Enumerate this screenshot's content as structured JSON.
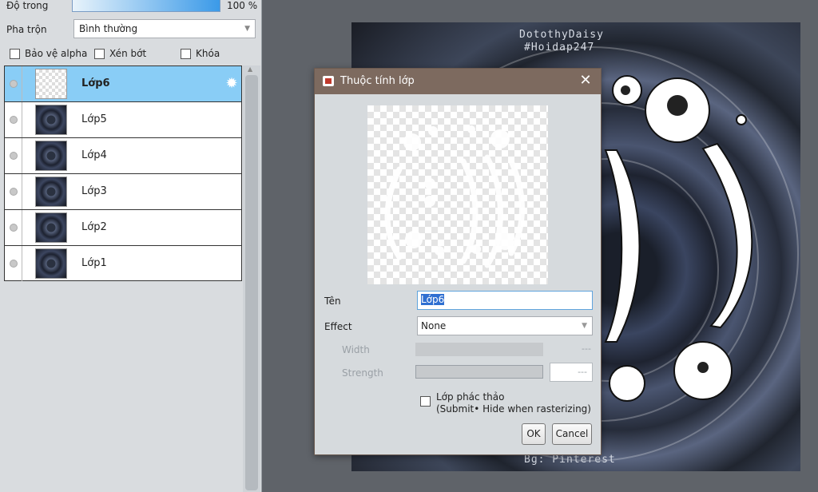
{
  "layer_panel": {
    "opacity_label": "Độ trong",
    "opacity_value": "100 %",
    "blend_label": "Pha trộn",
    "blend_mode": "Bình thường",
    "protect_alpha": "Bảo vệ alpha",
    "clipping": "Xén bớt",
    "lock": "Khóa",
    "layers": [
      {
        "name": "Lớp6",
        "selected": true
      },
      {
        "name": "Lớp5",
        "selected": false
      },
      {
        "name": "Lớp4",
        "selected": false
      },
      {
        "name": "Lớp3",
        "selected": false
      },
      {
        "name": "Lớp2",
        "selected": false
      },
      {
        "name": "Lớp1",
        "selected": false
      }
    ]
  },
  "canvas": {
    "watermark_name": "DotothyDaisy",
    "watermark_tag": "#Hoidap247",
    "watermark_bg": "Bg: Pinterest"
  },
  "dialog": {
    "title": "Thuộc tính lớp",
    "name_label": "Tên",
    "name_value": "Lớp6",
    "effect_label": "Effect",
    "effect_value": "None",
    "width_label": "Width",
    "width_value": "---",
    "strength_label": "Strength",
    "strength_value": "---",
    "draft_line1": "Lớp phác thảo",
    "draft_line2": "(Submit• Hide when rasterizing)",
    "ok": "OK",
    "cancel": "Cancel"
  },
  "colors": {
    "selection": "#89cdf6",
    "dialog_title": "#7d6a5f",
    "background": "#5f6369"
  }
}
